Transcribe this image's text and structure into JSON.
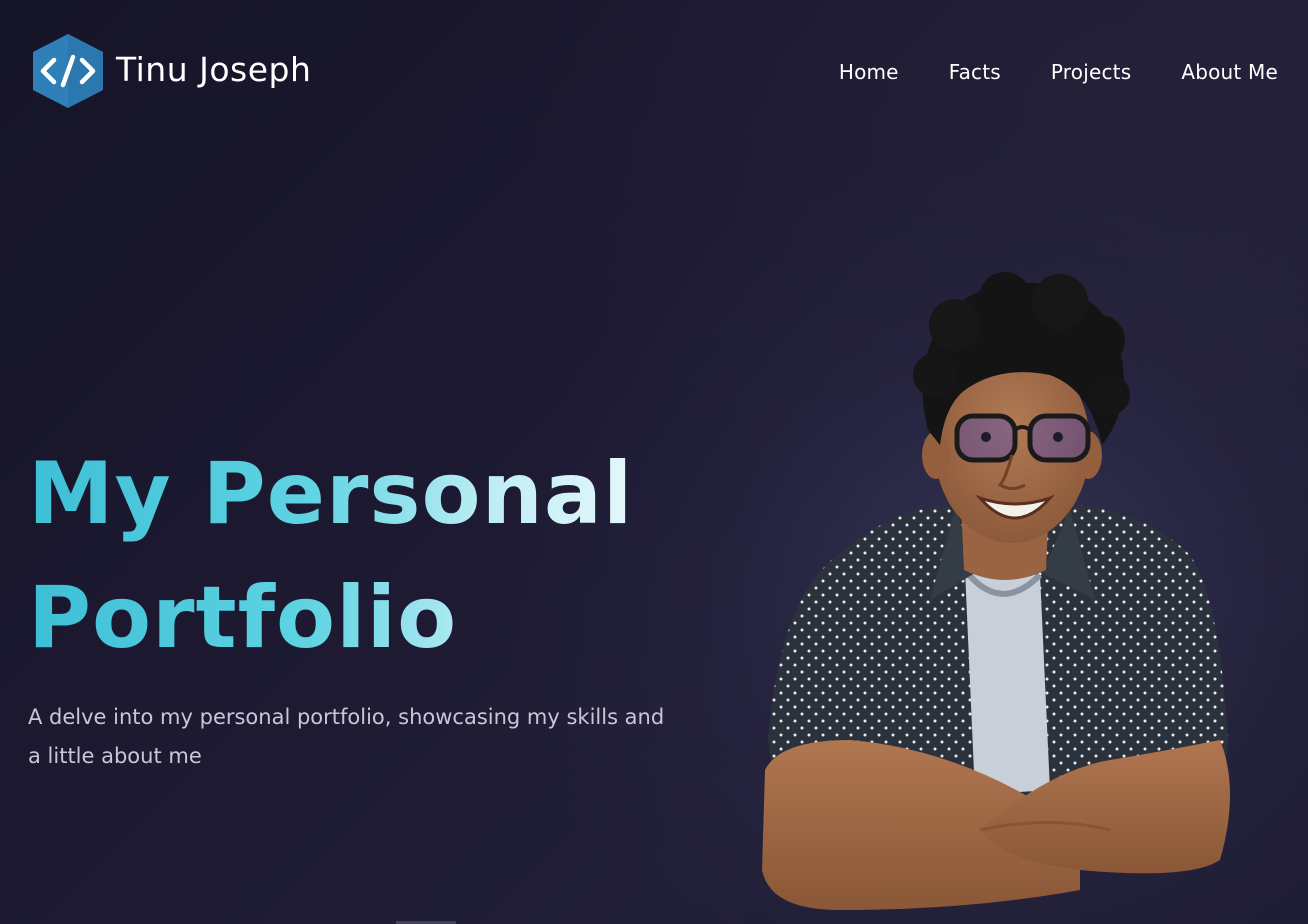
{
  "header": {
    "logo_icon": "code-brackets-icon",
    "brand_name": "Tinu Joseph",
    "nav": [
      "Home",
      "Facts",
      "Projects",
      "About Me"
    ]
  },
  "hero": {
    "title_line1": "My Personal",
    "title_line2": "Portfolio",
    "description": "A delve into my personal portfolio, showcasing my skills and a little about me"
  },
  "colors": {
    "background": "#1c1931",
    "accent_gradient_start": "#3dbfd6",
    "accent_gradient_end": "#e8f8fb",
    "logo_blue": "#2f7fb8"
  }
}
